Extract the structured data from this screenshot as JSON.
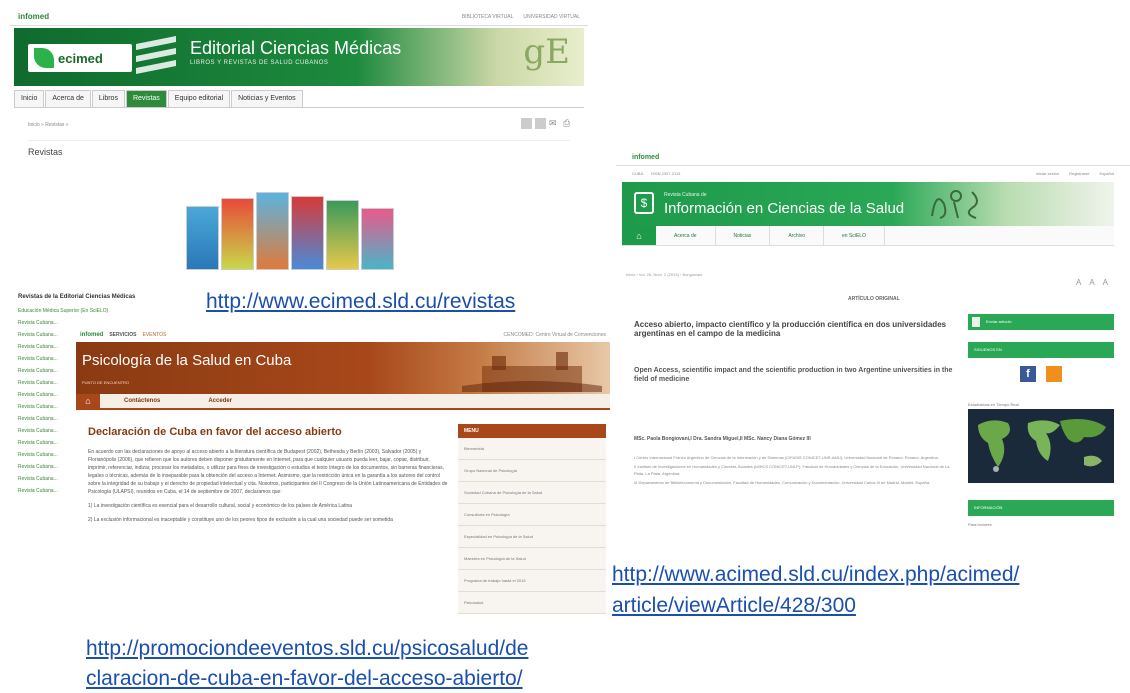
{
  "ecimed": {
    "top_logo": "infomed",
    "top_links": [
      "BIBLIOTECA VIRTUAL",
      "UNIVERSIDAD VIRTUAL"
    ],
    "brand": "ecimed",
    "title": "Editorial Ciencias Médicas",
    "subtitle": "LIBROS Y REVISTAS DE SALUD CUBANOS",
    "nav": [
      "Inicio",
      "Acerca de",
      "Libros",
      "Revistas",
      "Equipo editorial",
      "Noticias y Eventos"
    ],
    "nav_active": "Revistas",
    "breadcrumb": "Inicio » Revistas »",
    "heading": "Revistas",
    "list_heading": "Revistas de la Editorial Ciencias Médicas",
    "list_items": [
      "Educación Médica Superior (En SciELO)",
      "Revista Cubana...",
      "Revista Cubana...",
      "Revista Cubana...",
      "Revista Cubana...",
      "Revista Cubana...",
      "Revista Cubana...",
      "Revista Cubana...",
      "Revista Cubana...",
      "Revista Cubana...",
      "Revista Cubana...",
      "Revista Cubana...",
      "Revista Cubana...",
      "Revista Cubana...",
      "Revista Cubana...",
      "Revista Cubana..."
    ]
  },
  "psico": {
    "top_logo": "infomed",
    "top_servicios": "SERVICIOS",
    "top_eventos": "EVENTOS",
    "top_right": "CENCOMED: Centro Virtual de Convenciones",
    "title": "Psicología de la Salud en Cuba",
    "subtitle": "PUNTO DE ENCUENTRO",
    "nav": [
      "Contáctenos",
      "Acceder"
    ],
    "heading": "Declaración de Cuba en favor del acceso abierto",
    "paragraphs": [
      "En acuerdo con las declaraciones de apoyo al acceso abierto a la literatura científica de Budapest (2002), Bethesda y Berlín (2003), Salvador (2005) y Florianópolis (2006), que refieren que los autores deben disponer gratuitamente en Internet, para que cualquier usuario pueda leer, bajar, copiar, distribuir, imprimir, referenciar, indizar, procesar los metadatos, o utilizar para fines de investigación o estudios el texto íntegro de los documentos, sin barreras financieras, legales o técnicas, además de lo inseparable para la obtención del acceso a Internet. Asimismo, que la restricción única en la garantía a los autores del control sobre la integridad de su trabajo y el derecho de propiedad intelectual y cita. Nosotros, participantes del II Congreso de la Unión Latinoamericana de Entidades de Psicología (ULAPSI), reunidos en Cuba, el 14 de septiembre de 2007, declaramos que:",
      "1) La investigación científica es esencial para el desarrollo cultural, social y económico de los países de América Latina",
      "2) La exclusión informacional es inaceptable y constituye uno de los peores tipos de exclusión a la cual una sociedad puede ser sometida"
    ],
    "menu_title": "MENU",
    "menu_items": [
      "Bienvenida",
      "Grupo Nacional de Psicología",
      "Sociedad Cubana de Psicología de la Salud",
      "Consultoría en Psicología",
      "Especialidad en Psicología de la Salud",
      "Maestría en Psicología de la Salud",
      "Programa de trabajo hasta el 2015",
      "Psicosalud"
    ]
  },
  "acimed": {
    "top_logo": "infomed",
    "top_left": [
      "CUBA",
      "ISSN 2307-2113"
    ],
    "top_right": [
      "Iniciar sesión",
      "Registrarse",
      "Español"
    ],
    "banner_small": "Revista Cubana de",
    "title": "Información en Ciencias de la Salud",
    "nav": [
      "Acerca de",
      "Noticias",
      "Archivo",
      "en SciELO"
    ],
    "breadcrumb": "Inicio › Vol. 26, Núm. 2 (2015) › Bongiovani",
    "font_sizes": [
      "A",
      "A",
      "A"
    ],
    "kind": "ARTÍCULO ORIGINAL",
    "title_es": "Acceso abierto, impacto científico y la producción científica en dos universidades argentinas en el campo de la medicina",
    "title_en": "Open Access, scientific impact and the scientific production in two Argentine universities in the field of medicine",
    "authors": "MSc. Paola Bongiovani,I Dra. Sandra Miguel,II MSc. Nancy Diana Gómez III",
    "affiliations": [
      "I Centro Internacional Franco Argentino de Ciencias de la Información y de Sistemas (CIFASIS CONICET-UNR-AMU), Universidad Nacional de Rosario. Rosario, Argentina.",
      "II Instituto de Investigaciones en Humanidades y Ciencias Sociales (IdIHCS CONICET-UNLP), Facultad de Humanidades y Ciencias de la Educación, Universidad Nacional de La Plata. La Plata, Argentina.",
      "III Departamento de Biblioteconomía y Documentación, Facultad de Humanidades, Comunicación y Documentación, Universidad Carlos III de Madrid. Madrid, España."
    ],
    "side_send": "Enviar artículo",
    "side_follow": "SIGUENOS EN",
    "side_map_label": "Estadísticas en Tiempo Real",
    "side_info": "INFORMACIÓN",
    "side_info_item": "Para lectores"
  },
  "urls": {
    "ecimed": "http://www.ecimed.sld.cu/revistas",
    "acimed_1": "http://www.acimed.sld.cu/index.php/acimed/",
    "acimed_2": "article/viewArticle/428/300",
    "psico_1": "http://promociondeeventos.sld.cu/psicosalud/de",
    "psico_2": "claracion-de-cuba-en-favor-del-acceso-abierto/"
  },
  "colors": {
    "ecimed_green": "#1d8a3d",
    "psico_brown": "#a8481a",
    "acimed_green": "#2aa856",
    "link_blue": "#1a4fb0"
  }
}
